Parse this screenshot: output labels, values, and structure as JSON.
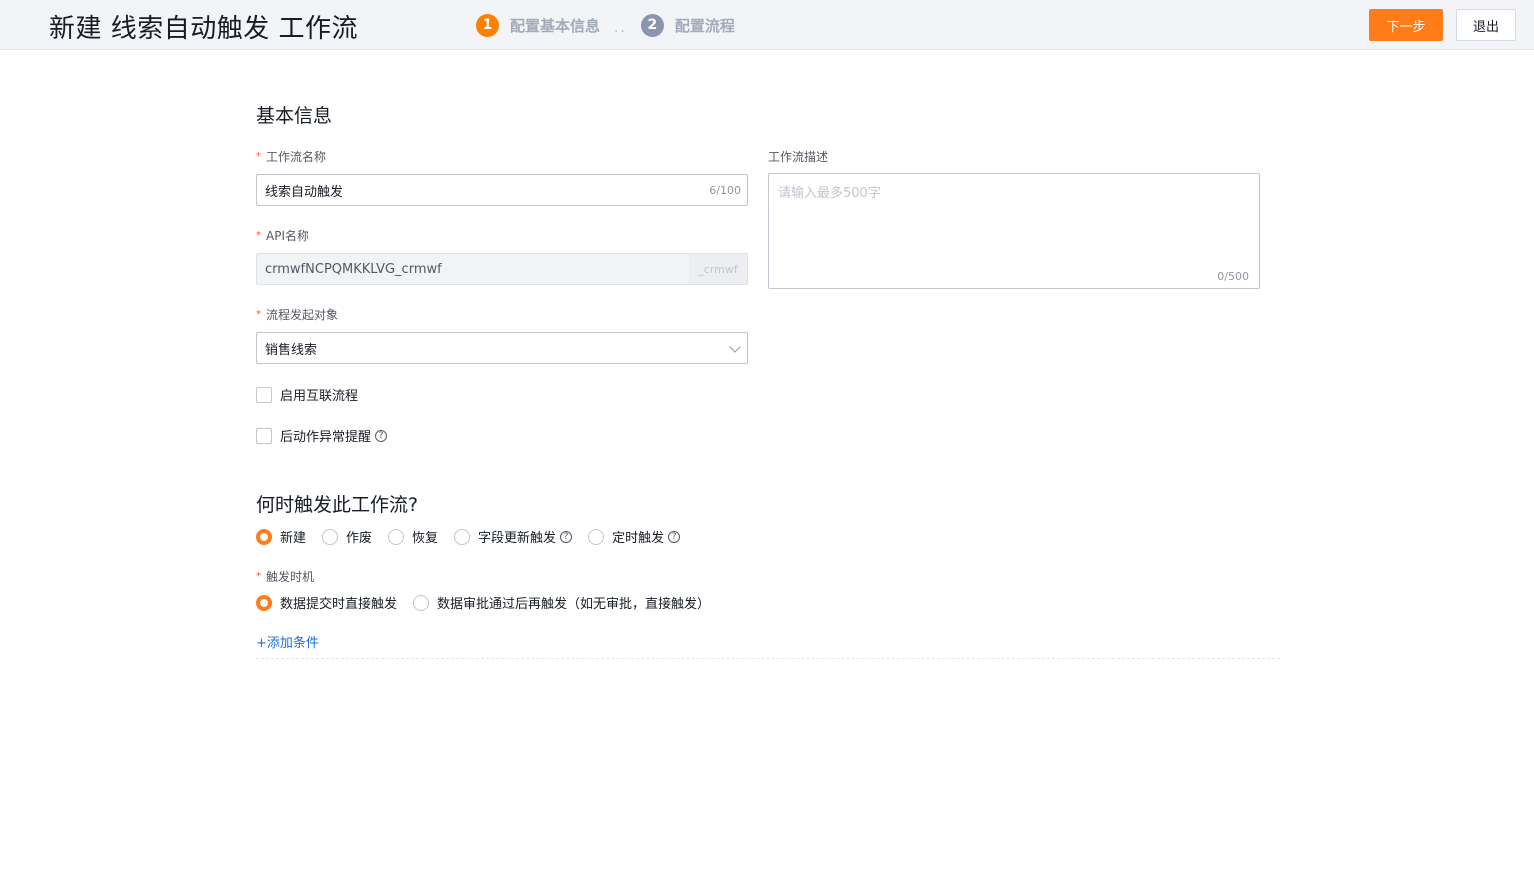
{
  "header": {
    "title": "新建 线索自动触发 工作流",
    "steps": [
      {
        "num": "1",
        "label": "配置基本信息",
        "state": "active"
      },
      {
        "num": "2",
        "label": "配置流程",
        "state": "inactive"
      }
    ],
    "step_separator": "..",
    "next_label": "下一步",
    "exit_label": "退出"
  },
  "basic": {
    "section_title": "基本信息",
    "name_label": "工作流名称",
    "name_value": "线索自动触发",
    "name_counter": "6/100",
    "api_label": "API名称",
    "api_value": "crmwfNCPQMKKLVG_crmwf",
    "api_suffix": "_crmwf",
    "object_label": "流程发起对象",
    "object_value": "销售线索",
    "desc_label": "工作流描述",
    "desc_placeholder": "请输入最多500字",
    "desc_counter": "0/500",
    "checkbox_interconnect": "启用互联流程",
    "checkbox_alert": "后动作异常提醒",
    "help_glyph": "?"
  },
  "trigger": {
    "section_title": "何时触发此工作流?",
    "types": [
      "新建",
      "作废",
      "恢复",
      "字段更新触发",
      "定时触发"
    ],
    "selected_type": "新建",
    "timing_label": "触发时机",
    "timing_options": [
      "数据提交时直接触发",
      "数据审批通过后再触发（如无审批，直接触发）"
    ],
    "selected_timing": "数据提交时直接触发",
    "add_condition": "+添加条件"
  },
  "colors": {
    "accent": "#ff7c19",
    "link": "#1a6fe0",
    "required": "#ff522a"
  }
}
